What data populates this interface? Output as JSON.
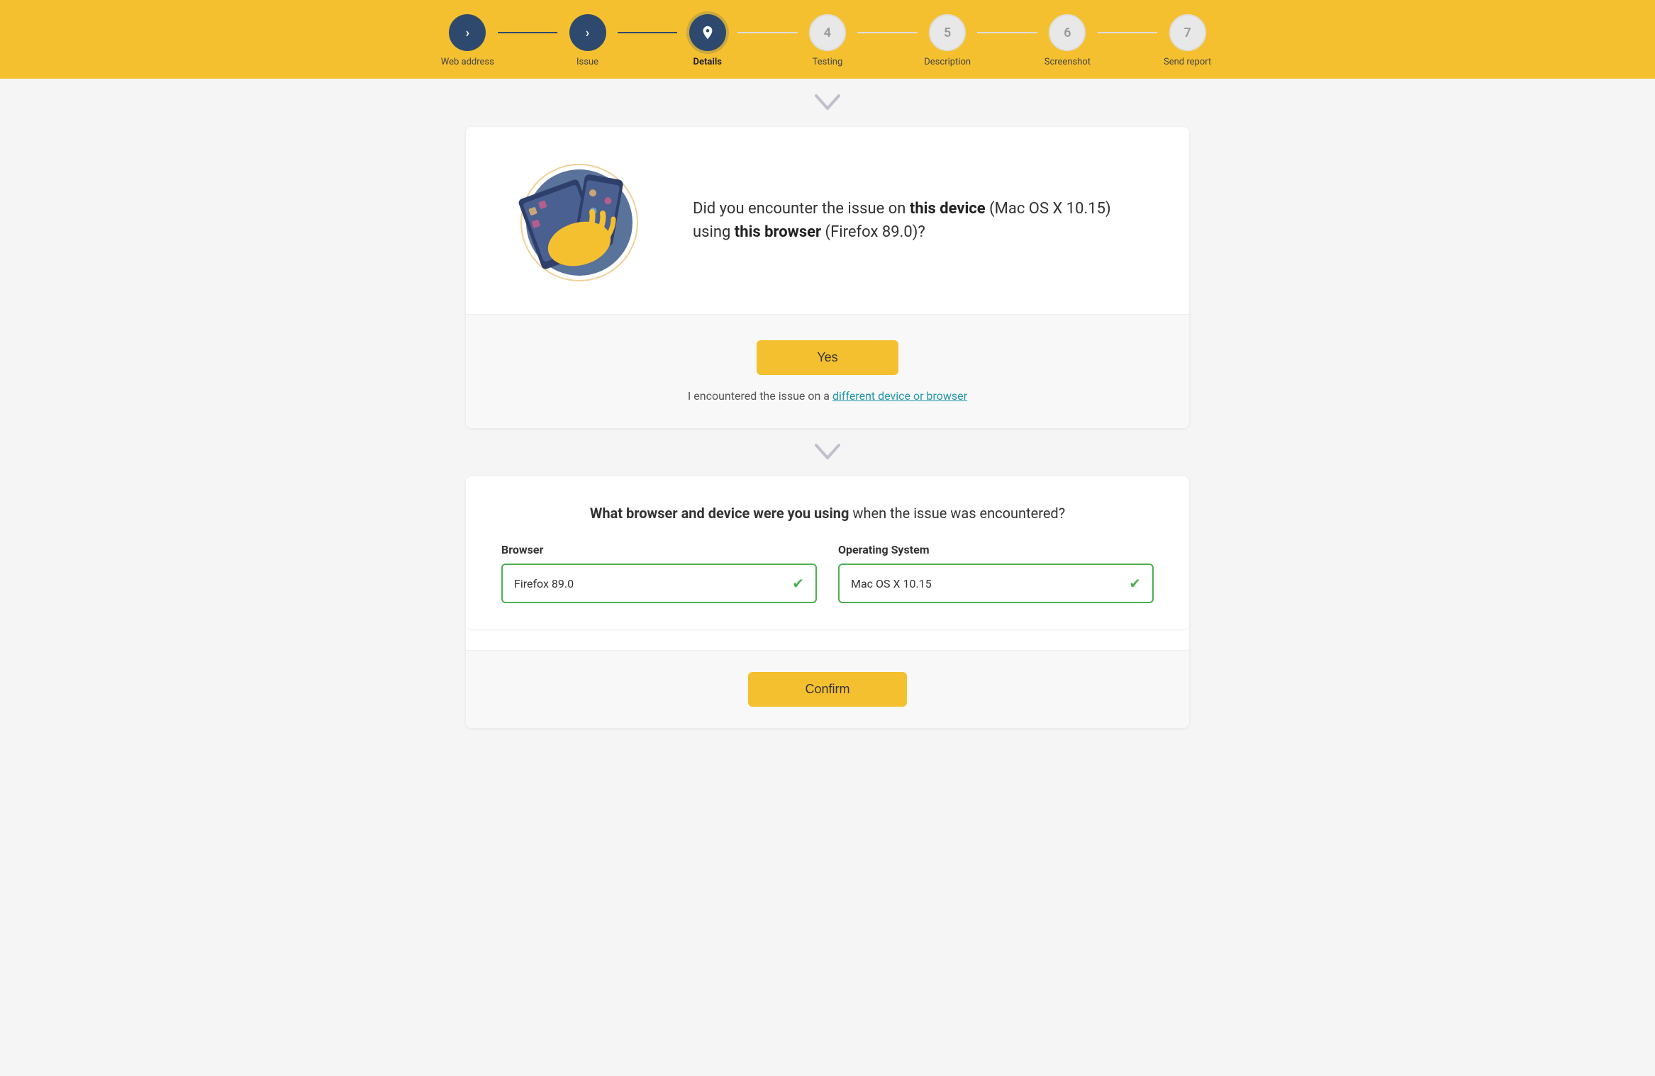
{
  "stepper": {
    "steps": [
      {
        "id": 1,
        "label": "Web address",
        "state": "completed",
        "icon": "chevron"
      },
      {
        "id": 2,
        "label": "Issue",
        "state": "completed",
        "icon": "chevron"
      },
      {
        "id": 3,
        "label": "Details",
        "state": "active",
        "icon": "pin"
      },
      {
        "id": 4,
        "label": "Testing",
        "state": "inactive",
        "number": "4"
      },
      {
        "id": 5,
        "label": "Description",
        "state": "inactive",
        "number": "5"
      },
      {
        "id": 6,
        "label": "Screenshot",
        "state": "inactive",
        "number": "6"
      },
      {
        "id": 7,
        "label": "Send report",
        "state": "inactive",
        "number": "7"
      }
    ]
  },
  "question_card": {
    "question_prefix": "Did you encounter the issue on ",
    "this_device": "this device",
    "device_info": " (Mac OS X 10.15) using ",
    "this_browser": "this browser",
    "browser_info": " (Firefox 89.0)?",
    "yes_button": "Yes",
    "different_device_prefix": "I encountered the issue on a ",
    "different_device_link": "different device or browser"
  },
  "browser_card": {
    "question_bold": "What browser and device were you using",
    "question_rest": " when the issue was encountered?",
    "browser_label": "Browser",
    "browser_value": "Firefox 89.0",
    "os_label": "Operating System",
    "os_value": "Mac OS X 10.15"
  },
  "confirm_button": "Confirm",
  "chevron_symbol": "∨"
}
